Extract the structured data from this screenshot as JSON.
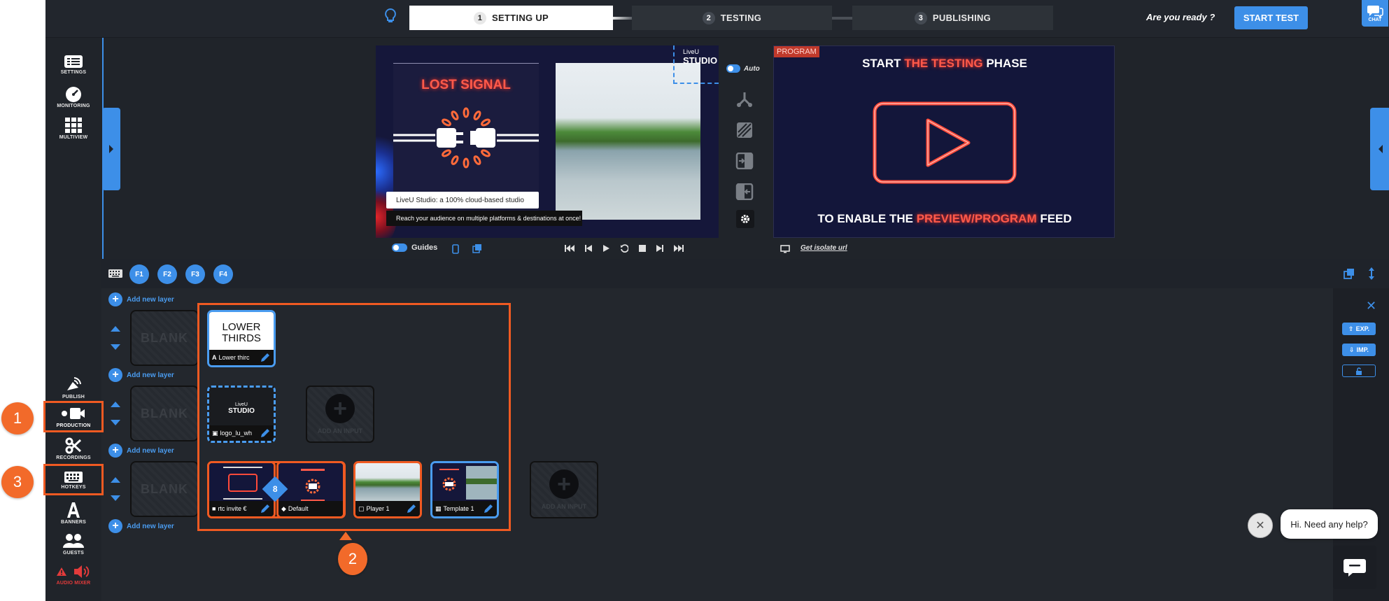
{
  "steps": [
    {
      "num": "1",
      "label": "SETTING UP"
    },
    {
      "num": "2",
      "label": "TESTING"
    },
    {
      "num": "3",
      "label": "PUBLISHING"
    }
  ],
  "header": {
    "ready_text": "Are you ready ?",
    "start_label": "START TEST",
    "chat_label": "CHAT"
  },
  "sidebar_top": [
    {
      "label": "SETTINGS",
      "icon": "settings-icon"
    },
    {
      "label": "MONITORING",
      "icon": "monitoring-icon"
    },
    {
      "label": "MULTIVIEW",
      "icon": "multiview-icon"
    }
  ],
  "sidebar_bottom": [
    {
      "label": "PUBLISH",
      "icon": "publish-icon"
    },
    {
      "label": "PRODUCTION",
      "icon": "production-icon"
    },
    {
      "label": "RECORDINGS",
      "icon": "recordings-icon"
    },
    {
      "label": "HOTKEYS",
      "icon": "hotkeys-icon"
    },
    {
      "label": "BANNERS",
      "icon": "banners-icon"
    },
    {
      "label": "GUESTS",
      "icon": "guests-icon"
    },
    {
      "label": "AUDIO MIXER",
      "icon": "audio-mixer-icon"
    }
  ],
  "preview": {
    "lost_signal": "LOST SIGNAL",
    "brand_line1": "LiveU",
    "brand_line2": "STUDIO",
    "banner1": "LiveU Studio: a 100% cloud-based studio",
    "banner2": "Reach your audience on multiple platforms & destinations at once!",
    "auto_label": "Auto",
    "guides_label": "Guides"
  },
  "program": {
    "tag": "PROGRAM",
    "title_a": "START ",
    "title_b": "THE TESTING",
    "title_c": " PHASE",
    "footer_a": "TO ENABLE THE ",
    "footer_b": "PREVIEW/PROGRAM",
    "footer_c": " FEED",
    "isolate_link": "Get isolate url"
  },
  "hotkeys": [
    "F1",
    "F2",
    "F3",
    "F4"
  ],
  "layers": {
    "add_label": "Add new layer",
    "blank_label": "BLANK",
    "add_input_label": "ADD AN INPUT",
    "row1": [
      {
        "title_line1": "LOWER",
        "title_line2": "THIRDS",
        "label": "Lower thirc"
      }
    ],
    "row2": [
      {
        "label": "logo_lu_wh"
      }
    ],
    "row3": [
      {
        "label": "rtc invite €",
        "badge": "8"
      },
      {
        "label": "Default"
      },
      {
        "label": "Player 1"
      },
      {
        "label": "Template 1"
      }
    ]
  },
  "right_panel": {
    "export_label": "EXP.",
    "import_label": "IMP."
  },
  "help": {
    "bubble": "Hi. Need any help?"
  },
  "callouts": [
    "1",
    "2",
    "3"
  ],
  "colors": {
    "accent": "#3d8fe8",
    "callout": "#f26a2a",
    "glow": "#ff5a4a",
    "bg": "#1f232a"
  }
}
